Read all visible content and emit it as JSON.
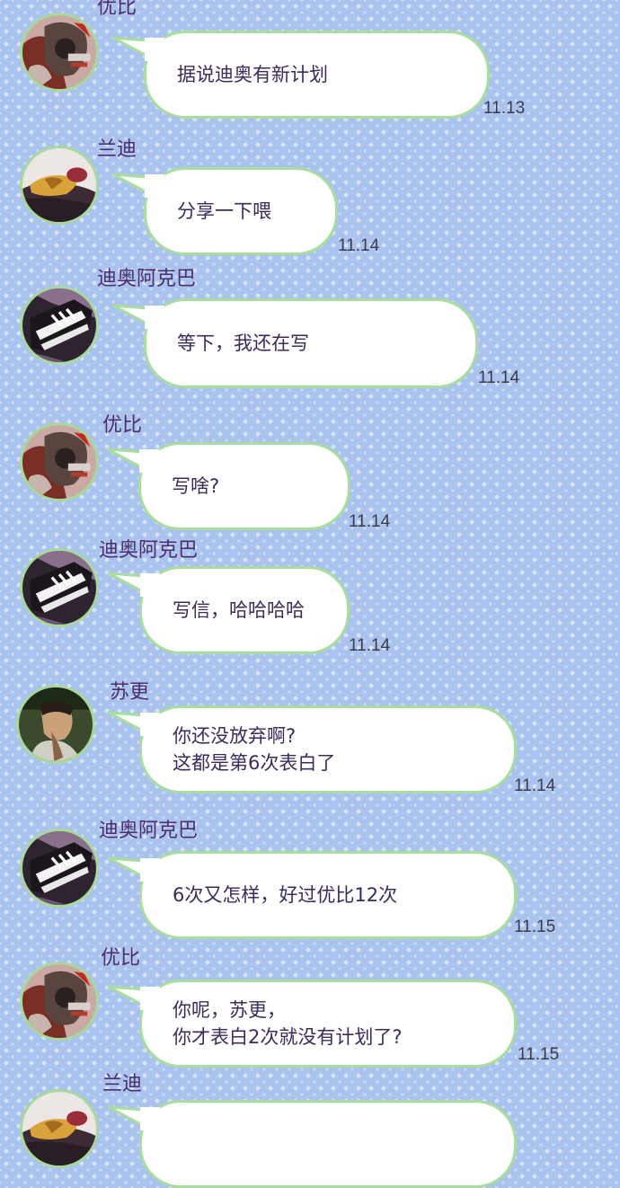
{
  "messages": [
    {
      "sender": "优比",
      "avatar": "youbi-avatar",
      "lines": [
        "据说迪奥有新计划"
      ],
      "time": "11.13"
    },
    {
      "sender": "兰迪",
      "avatar": "landi-avatar",
      "lines": [
        "分享一下喂"
      ],
      "time": "11.14"
    },
    {
      "sender": "迪奥阿克巴",
      "avatar": "sneaker-avatar",
      "lines": [
        "等下，我还在写"
      ],
      "time": "11.14"
    },
    {
      "sender": "优比",
      "avatar": "youbi-avatar",
      "lines": [
        "写啥?"
      ],
      "time": "11.14"
    },
    {
      "sender": "迪奥阿克巴",
      "avatar": "sneaker-avatar",
      "lines": [
        "写信，哈哈哈哈"
      ],
      "time": "11.14"
    },
    {
      "sender": "苏更",
      "avatar": "sugeng-avatar",
      "lines": [
        "你还没放弃啊?",
        "这都是第6次表白了"
      ],
      "time": "11.14"
    },
    {
      "sender": "迪奥阿克巴",
      "avatar": "sneaker-avatar",
      "lines": [
        "6次又怎样，好过优比12次"
      ],
      "time": "11.15"
    },
    {
      "sender": "优比",
      "avatar": "youbi-avatar",
      "lines": [
        "你呢，苏更，",
        "你才表白2次就没有计划了?"
      ],
      "time": "11.15"
    },
    {
      "sender": "兰迪",
      "avatar": "landi-avatar",
      "lines": [],
      "time": ""
    }
  ],
  "colors": {
    "background": "#a9c2ee",
    "bubble_border": "#a8dd9e",
    "bubble_fill": "#ffffff",
    "name_text": "#4a2f6b",
    "message_text": "#3d2a5c"
  }
}
